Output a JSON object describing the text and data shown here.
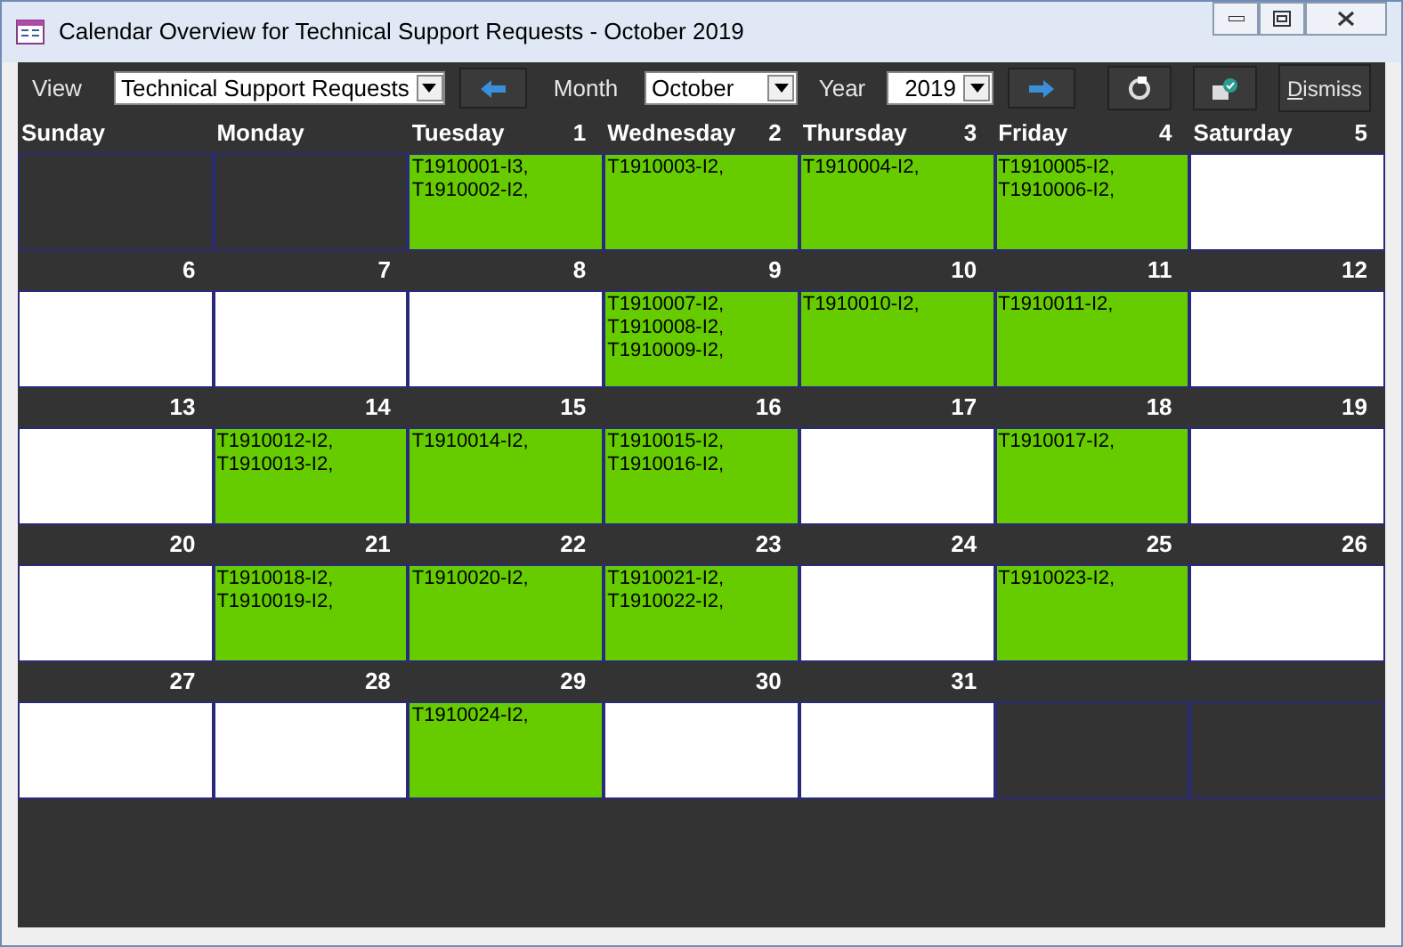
{
  "window": {
    "title": "Calendar Overview for Technical Support Requests - October 2019"
  },
  "toolbar": {
    "view_label": "View",
    "view_value": "Technical Support Requests",
    "month_label": "Month",
    "month_value": "October",
    "year_label": "Year",
    "year_value": "2019",
    "dismiss": "Dismiss"
  },
  "weeks": [
    {
      "header": [
        {
          "name": "Sunday"
        },
        {
          "name": "Monday"
        },
        {
          "name": "Tuesday",
          "day": "1"
        },
        {
          "name": "Wednesday",
          "day": "2"
        },
        {
          "name": "Thursday",
          "day": "3"
        },
        {
          "name": "Friday",
          "day": "4"
        },
        {
          "name": "Saturday",
          "day": "5"
        }
      ],
      "cells": [
        {
          "kind": "outside"
        },
        {
          "kind": "outside"
        },
        {
          "kind": "day",
          "busy": true,
          "entries": [
            "T1910001-I3,",
            "T1910002-I2,"
          ]
        },
        {
          "kind": "day",
          "busy": true,
          "entries": [
            "T1910003-I2,"
          ]
        },
        {
          "kind": "day",
          "busy": true,
          "entries": [
            "T1910004-I2,"
          ]
        },
        {
          "kind": "day",
          "busy": true,
          "entries": [
            "T1910005-I2,",
            "T1910006-I2,"
          ]
        },
        {
          "kind": "day",
          "busy": false
        }
      ]
    },
    {
      "header": [
        {
          "day": "6"
        },
        {
          "day": "7"
        },
        {
          "day": "8"
        },
        {
          "day": "9"
        },
        {
          "day": "10"
        },
        {
          "day": "11"
        },
        {
          "day": "12"
        }
      ],
      "cells": [
        {
          "kind": "day",
          "busy": false
        },
        {
          "kind": "day",
          "busy": false
        },
        {
          "kind": "day",
          "busy": false
        },
        {
          "kind": "day",
          "busy": true,
          "entries": [
            "T1910007-I2,",
            "T1910008-I2,",
            "T1910009-I2,"
          ]
        },
        {
          "kind": "day",
          "busy": true,
          "entries": [
            "T1910010-I2,"
          ]
        },
        {
          "kind": "day",
          "busy": true,
          "entries": [
            "T1910011-I2,"
          ]
        },
        {
          "kind": "day",
          "busy": false
        }
      ]
    },
    {
      "header": [
        {
          "day": "13"
        },
        {
          "day": "14"
        },
        {
          "day": "15"
        },
        {
          "day": "16"
        },
        {
          "day": "17"
        },
        {
          "day": "18"
        },
        {
          "day": "19"
        }
      ],
      "cells": [
        {
          "kind": "day",
          "busy": false
        },
        {
          "kind": "day",
          "busy": true,
          "entries": [
            "T1910012-I2,",
            "T1910013-I2,"
          ]
        },
        {
          "kind": "day",
          "busy": true,
          "entries": [
            "T1910014-I2,"
          ]
        },
        {
          "kind": "day",
          "busy": true,
          "entries": [
            "T1910015-I2,",
            "T1910016-I2,"
          ]
        },
        {
          "kind": "day",
          "busy": false
        },
        {
          "kind": "day",
          "busy": true,
          "entries": [
            "T1910017-I2,"
          ]
        },
        {
          "kind": "day",
          "busy": false
        }
      ]
    },
    {
      "header": [
        {
          "day": "20"
        },
        {
          "day": "21"
        },
        {
          "day": "22"
        },
        {
          "day": "23"
        },
        {
          "day": "24"
        },
        {
          "day": "25"
        },
        {
          "day": "26"
        }
      ],
      "cells": [
        {
          "kind": "day",
          "busy": false
        },
        {
          "kind": "day",
          "busy": true,
          "entries": [
            "T1910018-I2,",
            "T1910019-I2,"
          ]
        },
        {
          "kind": "day",
          "busy": true,
          "entries": [
            "T1910020-I2,"
          ]
        },
        {
          "kind": "day",
          "busy": true,
          "entries": [
            "T1910021-I2,",
            "T1910022-I2,"
          ]
        },
        {
          "kind": "day",
          "busy": false
        },
        {
          "kind": "day",
          "busy": true,
          "entries": [
            "T1910023-I2,"
          ]
        },
        {
          "kind": "day",
          "busy": false
        }
      ]
    },
    {
      "header": [
        {
          "day": "27"
        },
        {
          "day": "28"
        },
        {
          "day": "29"
        },
        {
          "day": "30"
        },
        {
          "day": "31"
        }
      ],
      "cells": [
        {
          "kind": "day",
          "busy": false
        },
        {
          "kind": "day",
          "busy": false
        },
        {
          "kind": "day",
          "busy": true,
          "entries": [
            "T1910024-I2,"
          ]
        },
        {
          "kind": "day",
          "busy": false
        },
        {
          "kind": "day",
          "busy": false
        },
        {
          "kind": "outside"
        },
        {
          "kind": "outside"
        }
      ]
    }
  ]
}
